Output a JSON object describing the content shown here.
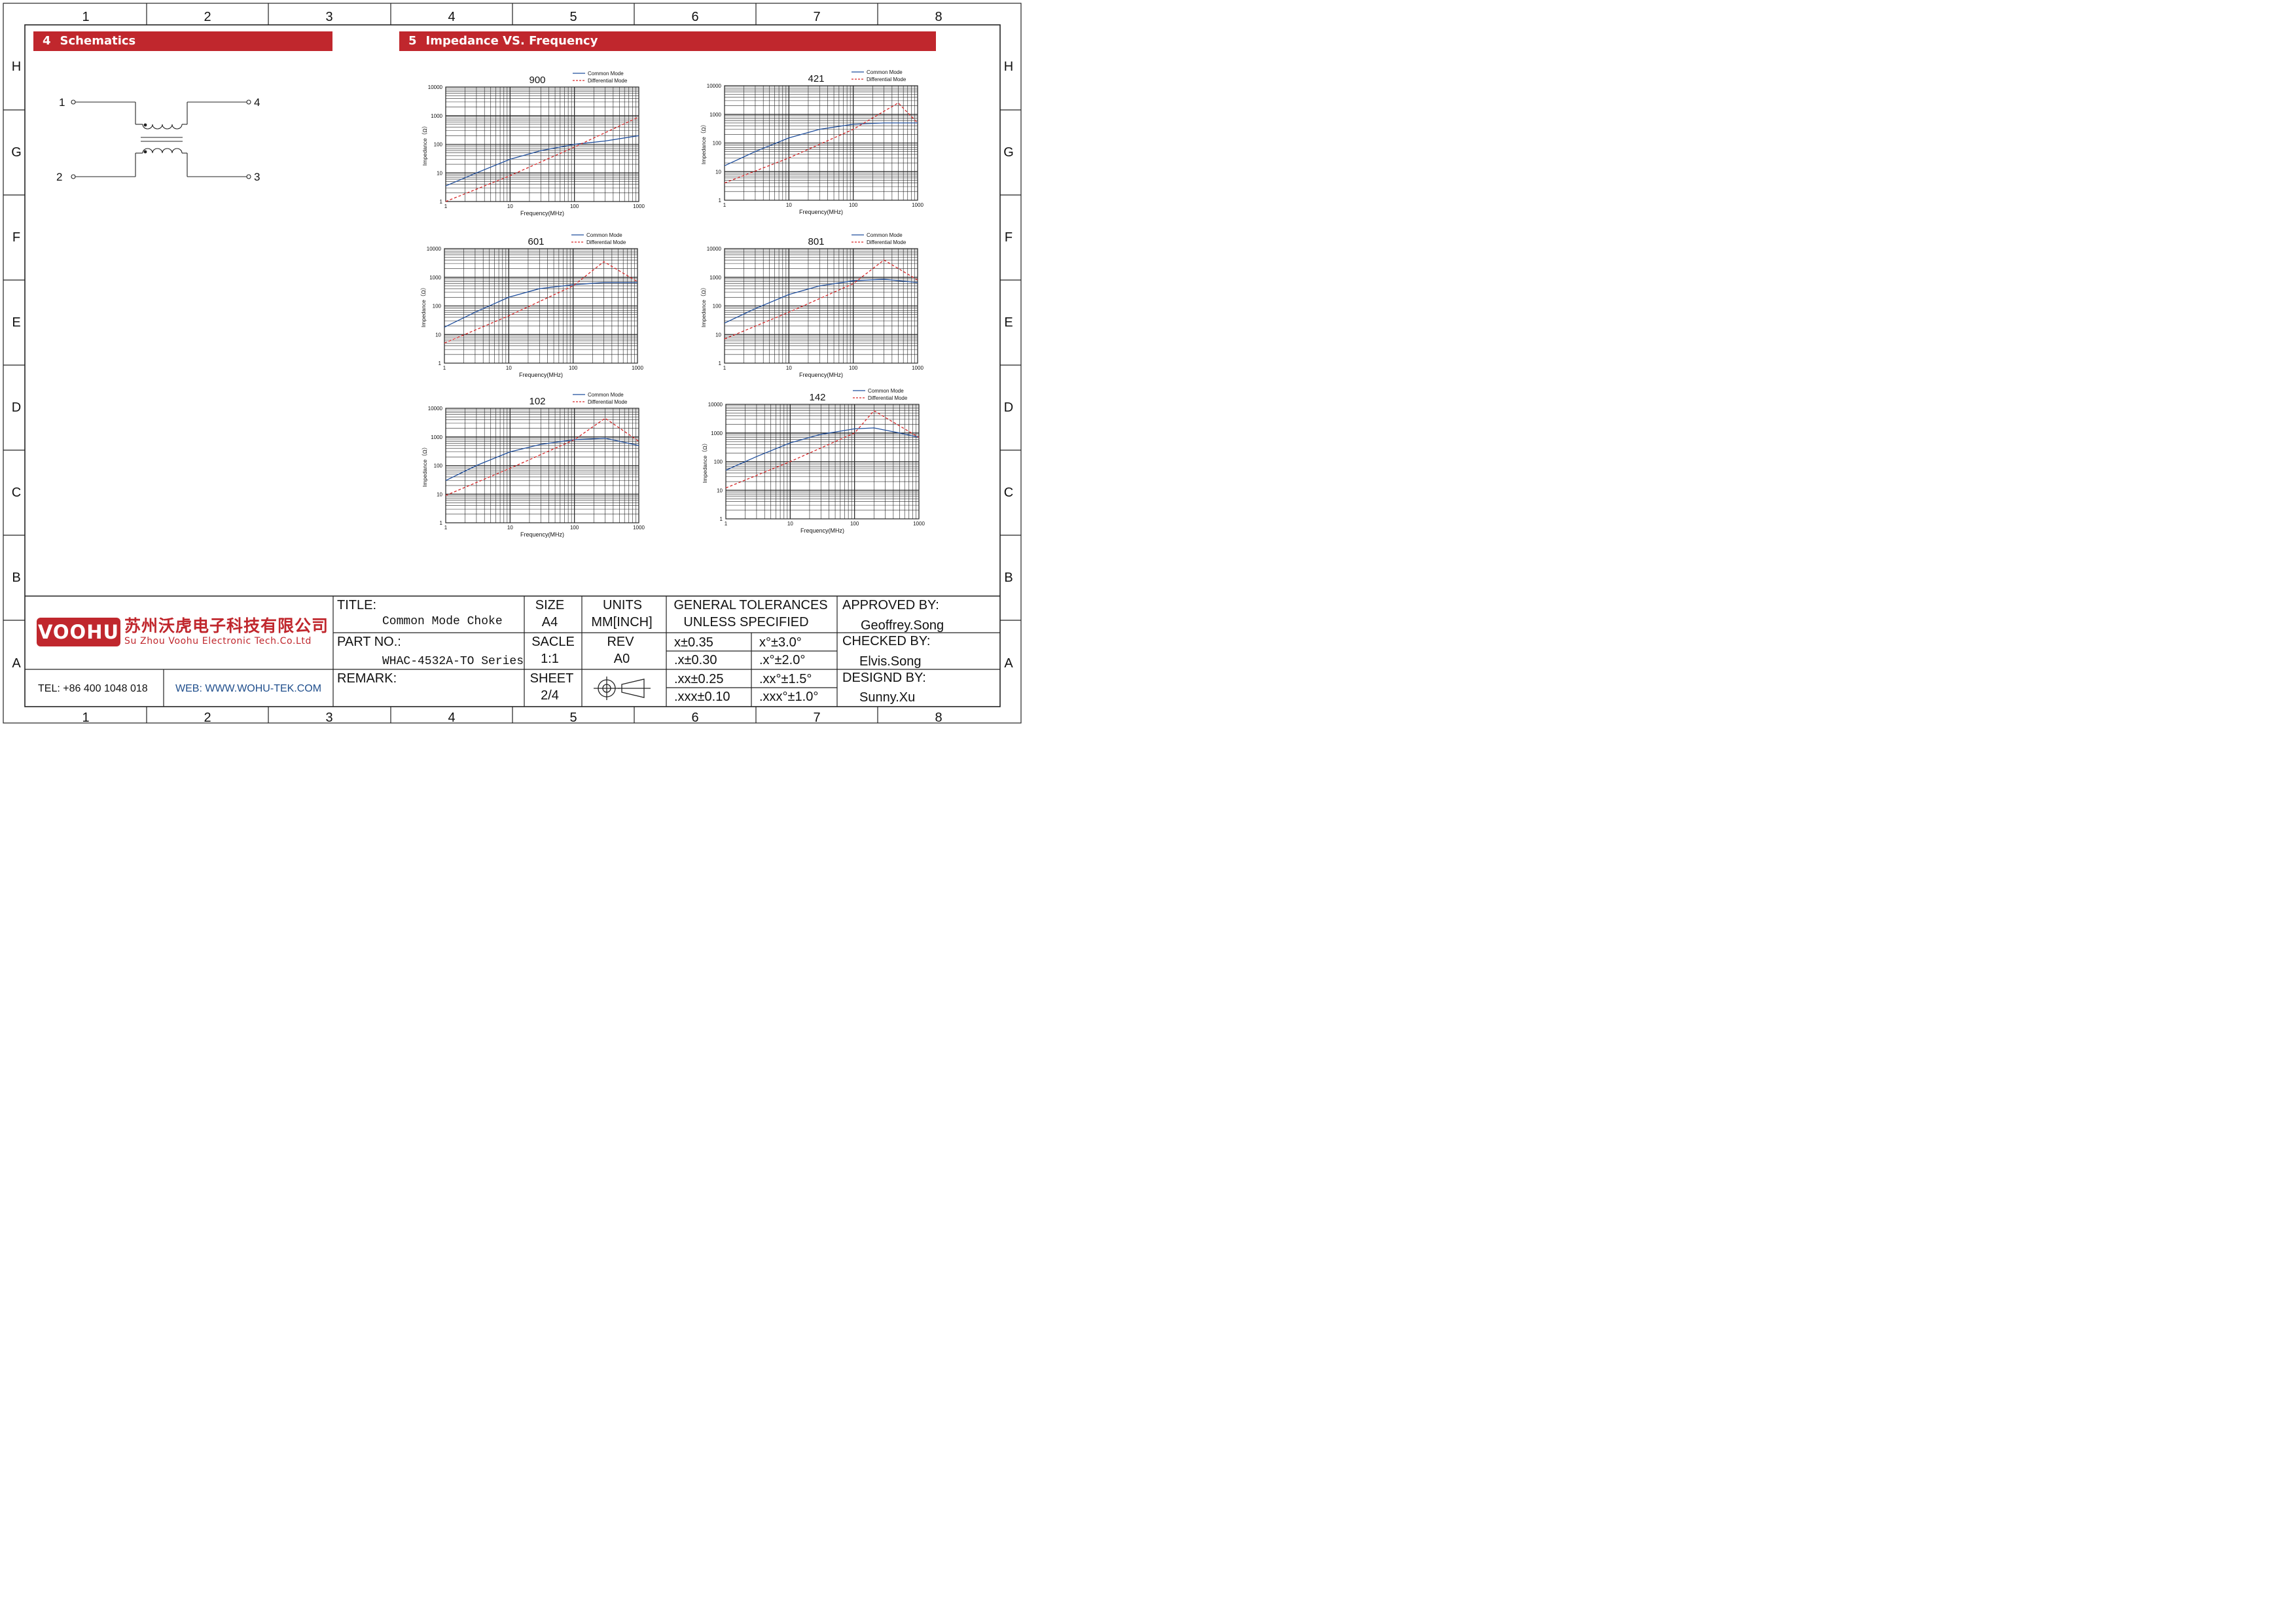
{
  "frame": {
    "columns": [
      "1",
      "2",
      "3",
      "4",
      "5",
      "6",
      "7",
      "8"
    ],
    "rows": [
      "H",
      "G",
      "F",
      "E",
      "D",
      "C",
      "B",
      "A"
    ]
  },
  "sections": {
    "schematics": {
      "num": "4",
      "title": "Schematics"
    },
    "impedance": {
      "num": "5",
      "title": "Impedance VS. Frequency"
    }
  },
  "schematic": {
    "pins": [
      "1",
      "2",
      "3",
      "4"
    ]
  },
  "colors": {
    "accent": "#c0272d",
    "common_mode": "#1f4e9c",
    "differential_mode": "#d62728",
    "link": "#1f4e8c"
  },
  "chart_data": [
    {
      "type": "line",
      "title": "900",
      "xlabel": "Frequency(MHz)",
      "ylabel": "Impedance（Ω）",
      "xscale": "log",
      "yscale": "log",
      "xlim": [
        1,
        1000
      ],
      "ylim": [
        1,
        10000
      ],
      "xticks": [
        "1",
        "10",
        "100",
        "1000"
      ],
      "yticks": [
        "1",
        "10",
        "100",
        "1000",
        "10000"
      ],
      "legend": "top-right",
      "series": [
        {
          "name": "Common Mode",
          "style": "solid",
          "x": [
            1,
            3,
            10,
            30,
            100,
            300,
            1000
          ],
          "y": [
            3.5,
            10,
            30,
            60,
            100,
            130,
            200
          ]
        },
        {
          "name": "Differential Mode",
          "style": "dashed",
          "x": [
            1,
            10,
            100,
            1000
          ],
          "y": [
            1,
            8,
            80,
            900
          ]
        }
      ]
    },
    {
      "type": "line",
      "title": "421",
      "xlabel": "Frequency(MHz)",
      "ylabel": "Impedance（Ω）",
      "xscale": "log",
      "yscale": "log",
      "xlim": [
        1,
        1000
      ],
      "ylim": [
        1,
        10000
      ],
      "xticks": [
        "1",
        "10",
        "100",
        "1000"
      ],
      "yticks": [
        "1",
        "10",
        "100",
        "1000",
        "10000"
      ],
      "legend": "top-right",
      "series": [
        {
          "name": "Common Mode",
          "style": "solid",
          "x": [
            1,
            3,
            10,
            30,
            100,
            300,
            1000
          ],
          "y": [
            16,
            50,
            150,
            300,
            450,
            500,
            500
          ]
        },
        {
          "name": "Differential Mode",
          "style": "dashed",
          "x": [
            1,
            10,
            100,
            500,
            1000
          ],
          "y": [
            4,
            30,
            300,
            2500,
            500
          ]
        }
      ]
    },
    {
      "type": "line",
      "title": "601",
      "xlabel": "Frequency(MHz)",
      "ylabel": "Impedance（Ω）",
      "xscale": "log",
      "yscale": "log",
      "xlim": [
        1,
        1000
      ],
      "ylim": [
        1,
        10000
      ],
      "xticks": [
        "1",
        "10",
        "100",
        "1000"
      ],
      "yticks": [
        "1",
        "10",
        "100",
        "1000",
        "10000"
      ],
      "legend": "top-right",
      "series": [
        {
          "name": "Common Mode",
          "style": "solid",
          "x": [
            1,
            3,
            10,
            30,
            100,
            300,
            1000
          ],
          "y": [
            18,
            60,
            200,
            400,
            550,
            650,
            650
          ]
        },
        {
          "name": "Differential Mode",
          "style": "dashed",
          "x": [
            1,
            10,
            100,
            300,
            1000
          ],
          "y": [
            5,
            45,
            500,
            3500,
            700
          ]
        }
      ]
    },
    {
      "type": "line",
      "title": "801",
      "xlabel": "Frequency(MHz)",
      "ylabel": "Impedance（Ω）",
      "xscale": "log",
      "yscale": "log",
      "xlim": [
        1,
        1000
      ],
      "ylim": [
        1,
        10000
      ],
      "xticks": [
        "1",
        "10",
        "100",
        "1000"
      ],
      "yticks": [
        "1",
        "10",
        "100",
        "1000",
        "10000"
      ],
      "legend": "top-right",
      "series": [
        {
          "name": "Common Mode",
          "style": "solid",
          "x": [
            1,
            3,
            10,
            30,
            100,
            300,
            1000
          ],
          "y": [
            25,
            80,
            250,
            500,
            750,
            850,
            650
          ]
        },
        {
          "name": "Differential Mode",
          "style": "dashed",
          "x": [
            1,
            10,
            100,
            300,
            1000
          ],
          "y": [
            7,
            60,
            600,
            4000,
            800
          ]
        }
      ]
    },
    {
      "type": "line",
      "title": "102",
      "xlabel": "Frequency(MHz)",
      "ylabel": "Impedance（Ω）",
      "xscale": "log",
      "yscale": "log",
      "xlim": [
        1,
        1000
      ],
      "ylim": [
        1,
        10000
      ],
      "xticks": [
        "1",
        "10",
        "100",
        "1000"
      ],
      "yticks": [
        "1",
        "10",
        "100",
        "1000",
        "10000"
      ],
      "legend": "top-right",
      "series": [
        {
          "name": "Common Mode",
          "style": "solid",
          "x": [
            1,
            3,
            10,
            30,
            100,
            300,
            1000
          ],
          "y": [
            30,
            100,
            300,
            550,
            800,
            900,
            500
          ]
        },
        {
          "name": "Differential Mode",
          "style": "dashed",
          "x": [
            1,
            10,
            100,
            300,
            1000
          ],
          "y": [
            9,
            80,
            800,
            4500,
            700
          ]
        }
      ]
    },
    {
      "type": "line",
      "title": "142",
      "xlabel": "Frequency(MHz)",
      "ylabel": "Impedance（Ω）",
      "xscale": "log",
      "yscale": "log",
      "xlim": [
        1,
        1000
      ],
      "ylim": [
        1,
        10000
      ],
      "xticks": [
        "1",
        "10",
        "100",
        "1000"
      ],
      "yticks": [
        "1",
        "10",
        "100",
        "1000",
        "10000"
      ],
      "legend": "top-right",
      "series": [
        {
          "name": "Common Mode",
          "style": "solid",
          "x": [
            1,
            3,
            10,
            30,
            100,
            200,
            500,
            1000
          ],
          "y": [
            50,
            150,
            450,
            900,
            1400,
            1500,
            1000,
            700
          ]
        },
        {
          "name": "Differential Mode",
          "style": "dashed",
          "x": [
            1,
            10,
            100,
            200,
            1000
          ],
          "y": [
            12,
            100,
            1000,
            6000,
            700
          ]
        }
      ]
    }
  ],
  "title_block": {
    "title_label": "TITLE:",
    "title_value": "Common Mode Choke",
    "part_label": "PART NO.:",
    "part_value": "WHAC-4532A-TO Series",
    "remark_label": "REMARK:",
    "size_label": "SIZE",
    "size_value": "A4",
    "units_label": "UNITS",
    "units_value": "MM[INCH]",
    "scale_label": "SACLE",
    "scale_value": "1:1",
    "rev_label": "REV",
    "rev_value": "A0",
    "sheet_label": "SHEET",
    "sheet_value": "2/4",
    "tol_title1": "GENERAL TOLERANCES",
    "tol_title2": "UNLESS SPECIFIED",
    "tolerances": [
      {
        "linear": "x±0.35",
        "angular": "x°±3.0°"
      },
      {
        "linear": ".x±0.30",
        "angular": ".x°±2.0°"
      },
      {
        "linear": ".xx±0.25",
        "angular": ".xx°±1.5°"
      },
      {
        "linear": ".xxx±0.10",
        "angular": ".xxx°±1.0°"
      }
    ],
    "approved_label": "APPROVED BY:",
    "approved_value": "Geoffrey.Song",
    "checked_label": "CHECKED BY:",
    "checked_value": "Elvis.Song",
    "designed_label": "DESIGND BY:",
    "designed_value": "Sunny.Xu"
  },
  "company": {
    "logo": "VOOHU",
    "name_cn": "苏州沃虎电子科技有限公司",
    "name_en": "Su Zhou Voohu Electronic Tech.Co.Ltd",
    "tel": "TEL: +86 400 1048 018",
    "web": "WEB: WWW.WOHU-TEK.COM"
  }
}
